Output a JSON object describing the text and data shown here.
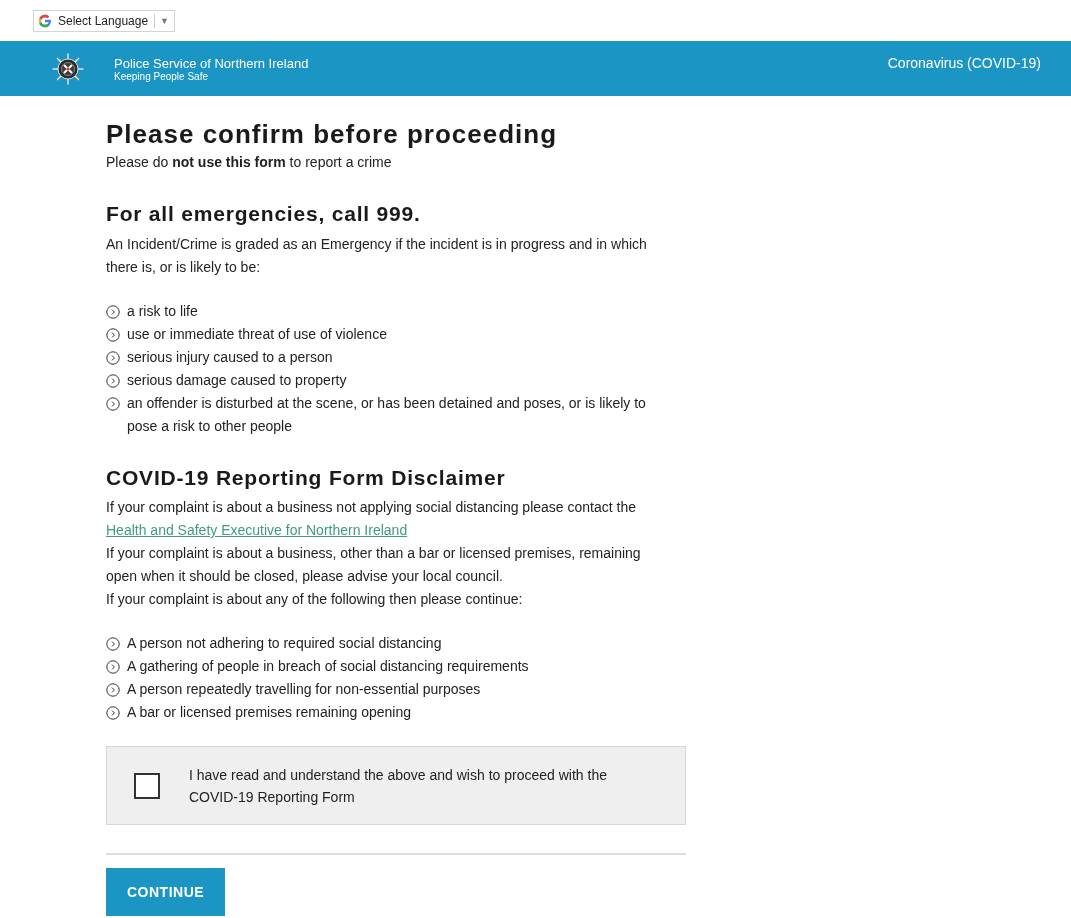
{
  "language_selector": {
    "label": "Select Language",
    "caret": "▼"
  },
  "header": {
    "org_name": "Police Service of Northern Ireland",
    "tagline": "Keeping People Safe",
    "nav_link": "Coronavirus (COVID-19)"
  },
  "page": {
    "title": "Please confirm before proceeding",
    "subtitle": "Please do **not use this form** to report a crime"
  },
  "emergency": {
    "heading": "For all emergencies, call 999.",
    "intro": "An Incident/Crime is graded as an Emergency if the incident is in progress and in which there is, or is likely to be:",
    "items": [
      "a risk to life",
      "use or immediate threat of use of violence",
      "serious injury caused to a person",
      "serious damage caused to property",
      "an offender is disturbed at the scene, or has been detained and poses, or is likely to pose a risk to other people"
    ]
  },
  "disclaimer": {
    "heading": "COVID-19 Reporting Form Disclaimer",
    "paragraphs": [
      {
        "kind": "text",
        "text": "If your complaint is about a business not applying social distancing please contact the"
      },
      {
        "kind": "link",
        "text": "Health and Safety Executive for Northern Ireland"
      },
      {
        "kind": "text",
        "text": "If your complaint is about a business, other than a bar or licensed premises, remaining open when it should be closed, please advise your local council."
      },
      {
        "kind": "text",
        "text": "If your complaint is about any of the following then please continue:"
      }
    ],
    "items": [
      "A person not adhering to required social distancing",
      "A gathering of people in breach of social distancing requirements",
      "A person repeatedly travelling for non-essential purposes",
      "A bar or licensed premises remaining opening"
    ]
  },
  "consent": {
    "label": "I have read and understand the above and wish to proceed with the COVID-19 Reporting Form",
    "checked": false
  },
  "continue_button": {
    "label": "CONTINUE"
  }
}
